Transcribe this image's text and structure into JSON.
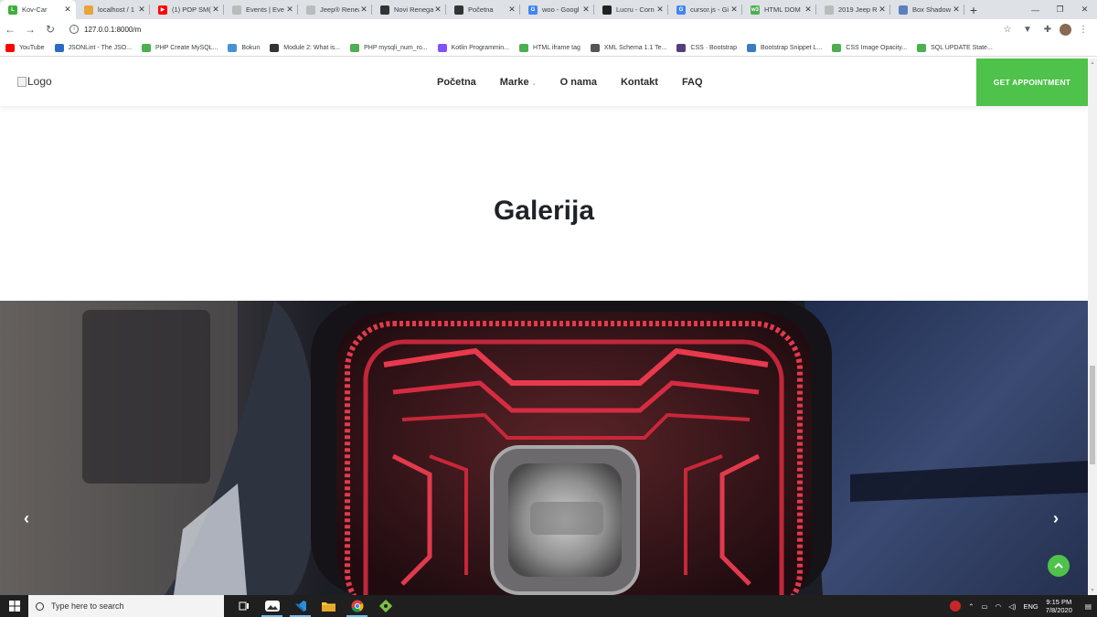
{
  "browser": {
    "tabs": [
      {
        "title": "Kov-Car",
        "fav_color": "#3fae3a",
        "fav_letter": "L",
        "active": true
      },
      {
        "title": "localhost / 1",
        "fav_color": "#e8a43a",
        "fav_letter": ""
      },
      {
        "title": "(1) POP SM(",
        "fav_color": "#ff0000",
        "fav_letter": "▶"
      },
      {
        "title": "Events | Eve",
        "fav_color": "#bbbbbb",
        "fav_letter": ""
      },
      {
        "title": "Jeep® Renea",
        "fav_color": "#bbbbbb",
        "fav_letter": ""
      },
      {
        "title": "Novi Renega",
        "fav_color": "#333333",
        "fav_letter": ""
      },
      {
        "title": "Početna",
        "fav_color": "#333333",
        "fav_letter": ""
      },
      {
        "title": "woo - Googl",
        "fav_color": "#4285f4",
        "fav_letter": "G"
      },
      {
        "title": "Lucru - Corn",
        "fav_color": "#222222",
        "fav_letter": ""
      },
      {
        "title": "cursor.js - Gi",
        "fav_color": "#4285f4",
        "fav_letter": "G"
      },
      {
        "title": "HTML DOM",
        "fav_color": "#4caf50",
        "fav_letter": "w3"
      },
      {
        "title": "2019 Jeep R",
        "fav_color": "#bbbbbb",
        "fav_letter": ""
      },
      {
        "title": "Box Shadow",
        "fav_color": "#5b7fbf",
        "fav_letter": ""
      }
    ],
    "new_tab_label": "+",
    "url": "127.0.0.1:8000/m",
    "bookmarks": [
      {
        "label": "YouTube",
        "fav_color": "#ff0000"
      },
      {
        "label": "JSONLint - The JSO...",
        "fav_color": "#2a6cc4"
      },
      {
        "label": "PHP Create MySQL...",
        "fav_color": "#4caf50"
      },
      {
        "label": "Bokun",
        "fav_color": "#4a90d9"
      },
      {
        "label": "Module 2: What is...",
        "fav_color": "#333333"
      },
      {
        "label": "PHP mysqli_num_ro...",
        "fav_color": "#4caf50"
      },
      {
        "label": "Kotlin Programmin...",
        "fav_color": "#7f52ff"
      },
      {
        "label": "HTML iframe tag",
        "fav_color": "#4caf50"
      },
      {
        "label": "XML Schema 1.1 Te...",
        "fav_color": "#555555"
      },
      {
        "label": "CSS · Bootstrap",
        "fav_color": "#563d7c"
      },
      {
        "label": "Bootstrap Snippet L...",
        "fav_color": "#3b7bbf"
      },
      {
        "label": "CSS Image Opacity...",
        "fav_color": "#4caf50"
      },
      {
        "label": "SQL UPDATE State...",
        "fav_color": "#4caf50"
      }
    ]
  },
  "site": {
    "logo_alt": "Logo",
    "nav": [
      {
        "label": "Početna",
        "has_dropdown": false
      },
      {
        "label": "Marke",
        "has_dropdown": true
      },
      {
        "label": "O nama",
        "has_dropdown": false
      },
      {
        "label": "Kontakt",
        "has_dropdown": false
      },
      {
        "label": "FAQ",
        "has_dropdown": false
      }
    ],
    "cta_label": "GET APPOINTMENT",
    "cta_color": "#4ec24a",
    "gallery_title": "Galerija",
    "prev_arrow": "‹",
    "next_arrow": "›"
  },
  "taskbar": {
    "search_placeholder": "Type here to search",
    "lang": "ENG",
    "time": "9:15 PM",
    "date": "7/8/2020"
  }
}
